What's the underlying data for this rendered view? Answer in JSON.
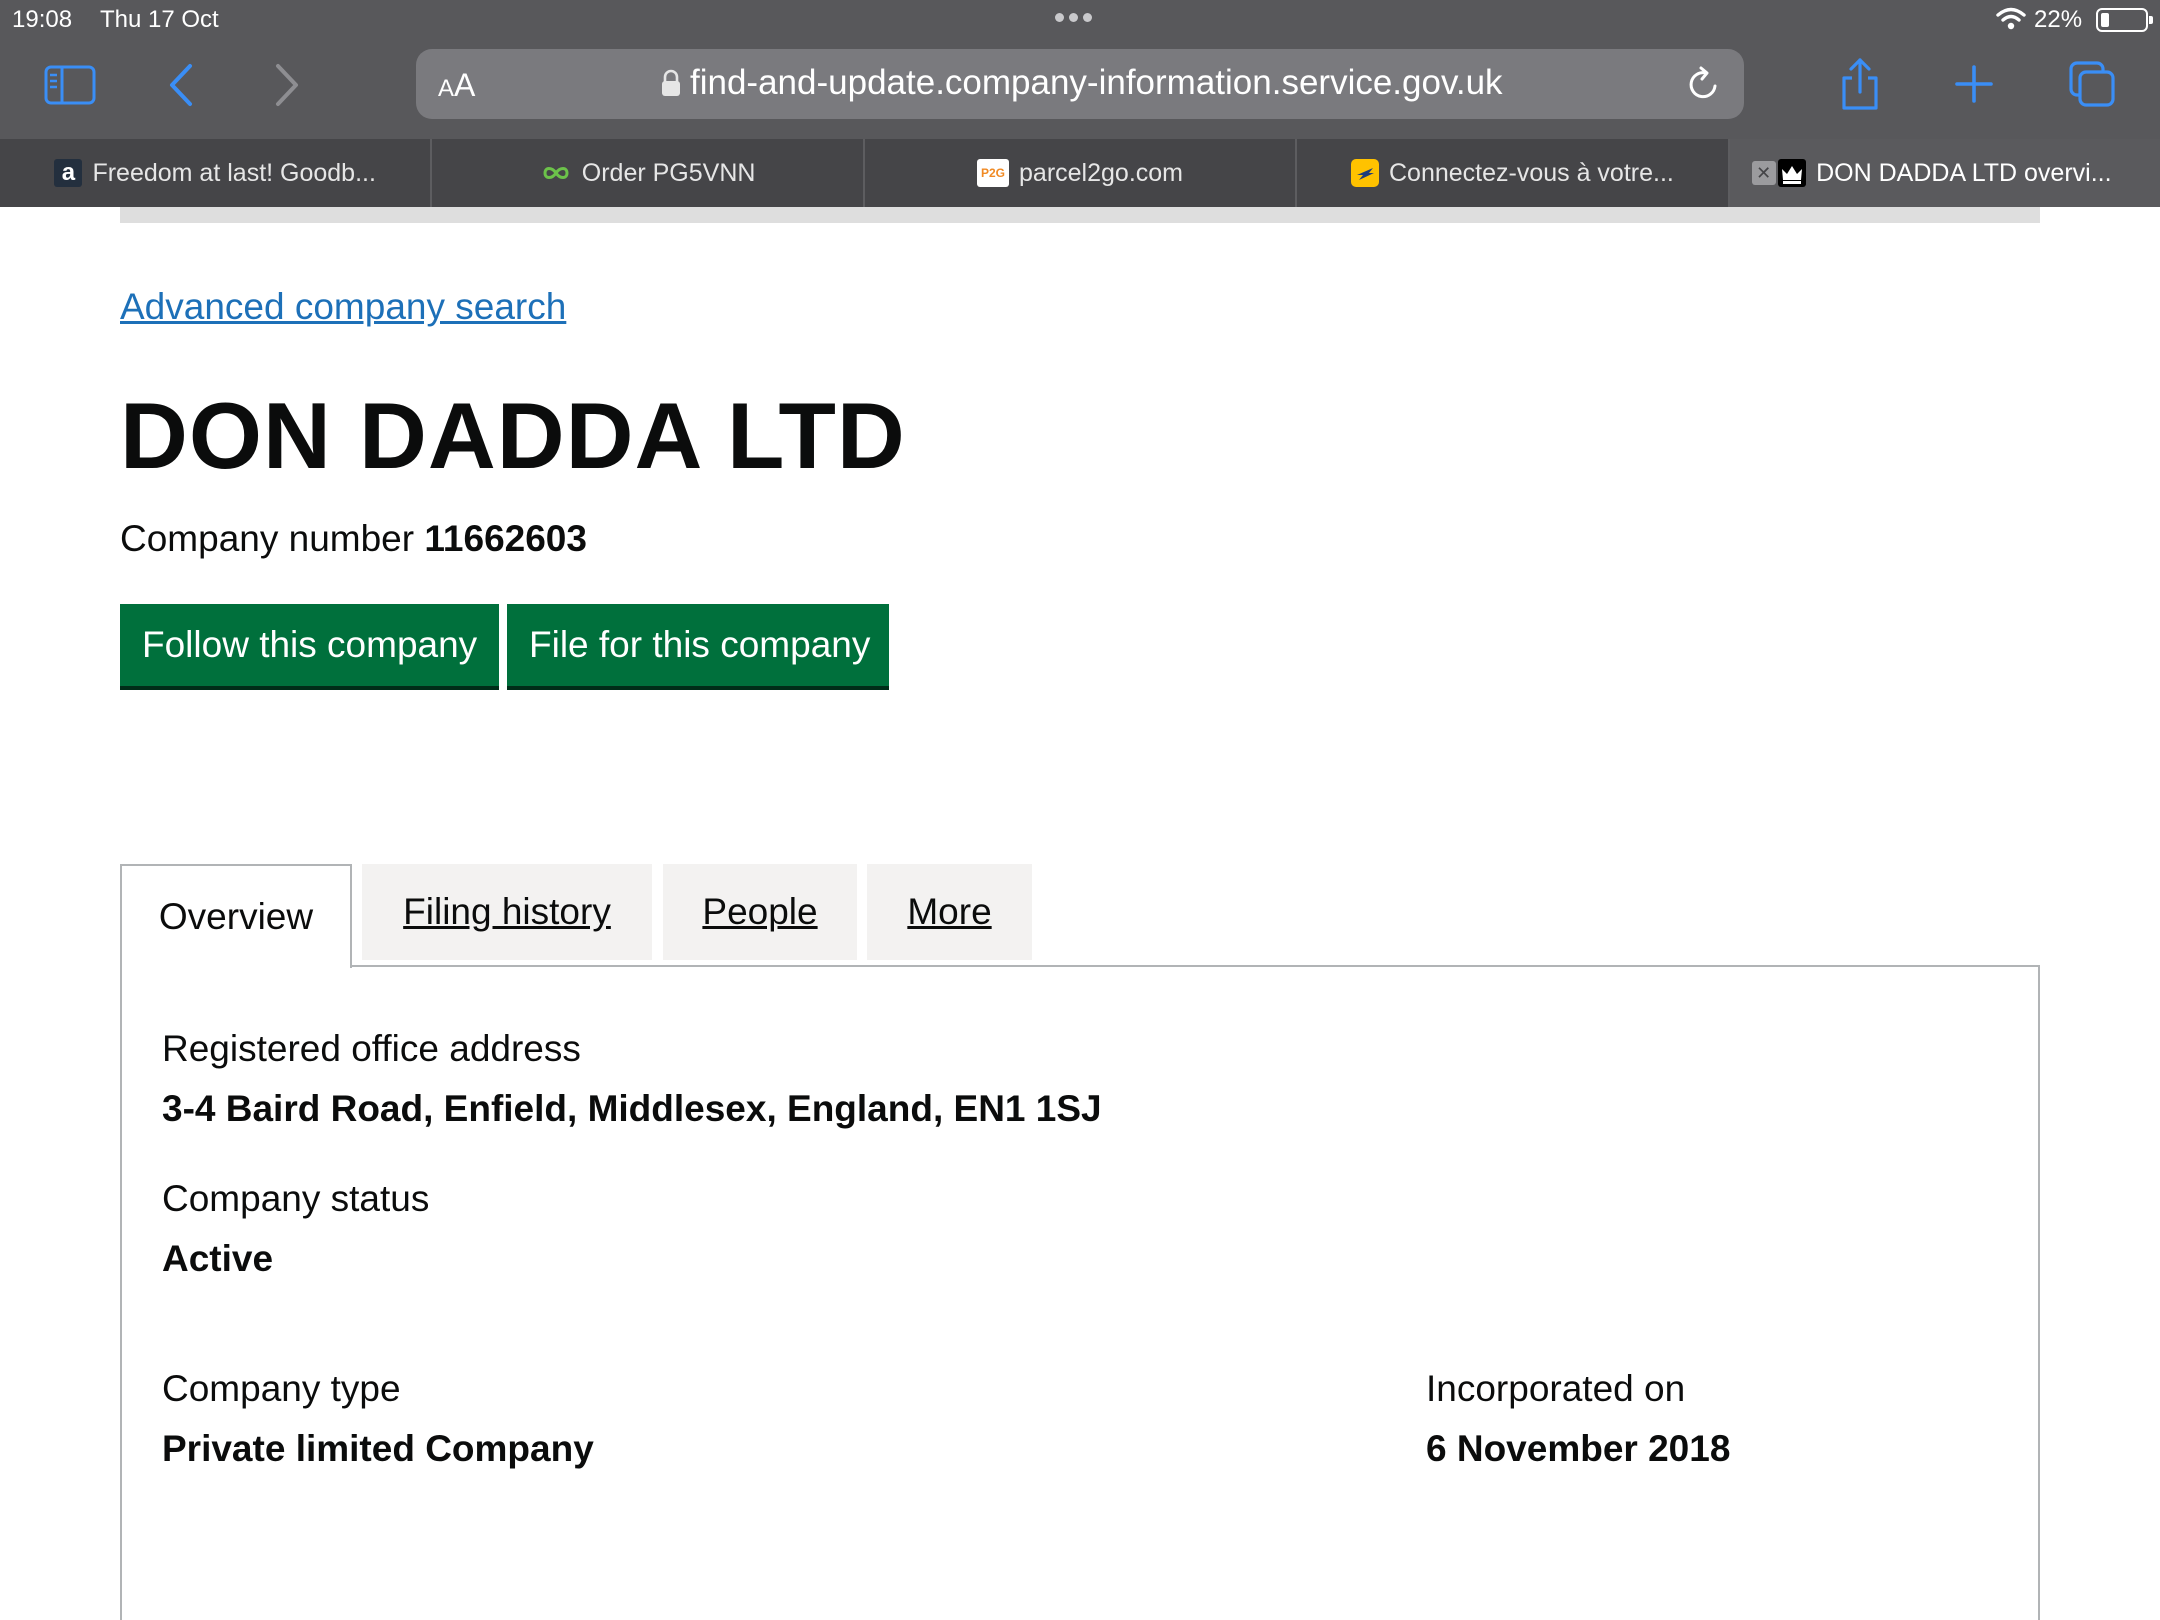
{
  "status_bar": {
    "time": "19:08",
    "date": "Thu 17 Oct",
    "battery": "22%",
    "battery_level": 0.22
  },
  "browser": {
    "text_size_button": "AA",
    "url": "find-and-update.company-information.service.gov.uk",
    "tabs": [
      {
        "title": "Freedom at last! Goodb...",
        "icon": "amazon-icon"
      },
      {
        "title": "Order PG5VNN",
        "icon": "infinity-icon"
      },
      {
        "title": "parcel2go.com",
        "icon": "parcel2go-icon"
      },
      {
        "title": "Connectez-vous à votre...",
        "icon": "laposte-icon"
      },
      {
        "title": "DON DADDA LTD overvi...",
        "icon": "crown-icon",
        "active": true
      }
    ]
  },
  "page": {
    "advanced_search_link": "Advanced company search",
    "company_name": "DON DADDA LTD",
    "company_number_label": "Company number",
    "company_number": "11662603",
    "buttons": {
      "follow": "Follow this company",
      "file": "File for this company"
    },
    "tabs": {
      "overview": "Overview",
      "filing_history": "Filing history",
      "people": "People",
      "more": "More"
    },
    "overview": {
      "registered_office_label": "Registered office address",
      "registered_office_value": "3-4 Baird Road, Enfield, Middlesex, England, EN1 1SJ",
      "status_label": "Company status",
      "status_value": "Active",
      "type_label": "Company type",
      "type_value": "Private limited Company",
      "incorporated_label": "Incorporated on",
      "incorporated_value": "6 November 2018"
    }
  },
  "colors": {
    "link": "#1d70b8",
    "button_green": "#00703c",
    "browser_chrome": "#58585b",
    "ios_blue": "#3a8ef6"
  }
}
